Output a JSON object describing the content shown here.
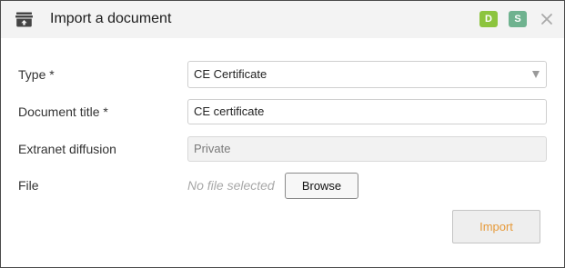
{
  "dialog": {
    "title": "Import a document",
    "header_icon": "archive-box-icon",
    "badges": [
      {
        "label": "D",
        "color": "#8cc43e"
      },
      {
        "label": "S",
        "color": "#6fb28f"
      }
    ],
    "close_icon": "close-icon"
  },
  "form": {
    "type": {
      "label": "Type *",
      "value": "CE Certificate"
    },
    "document_title": {
      "label": "Document title *",
      "value": "CE certificate"
    },
    "extranet_diffusion": {
      "label": "Extranet diffusion",
      "value": "Private"
    },
    "file": {
      "label": "File",
      "status": "No file selected",
      "browse_label": "Browse"
    }
  },
  "actions": {
    "import_label": "Import",
    "import_color": "#e69a3a"
  }
}
